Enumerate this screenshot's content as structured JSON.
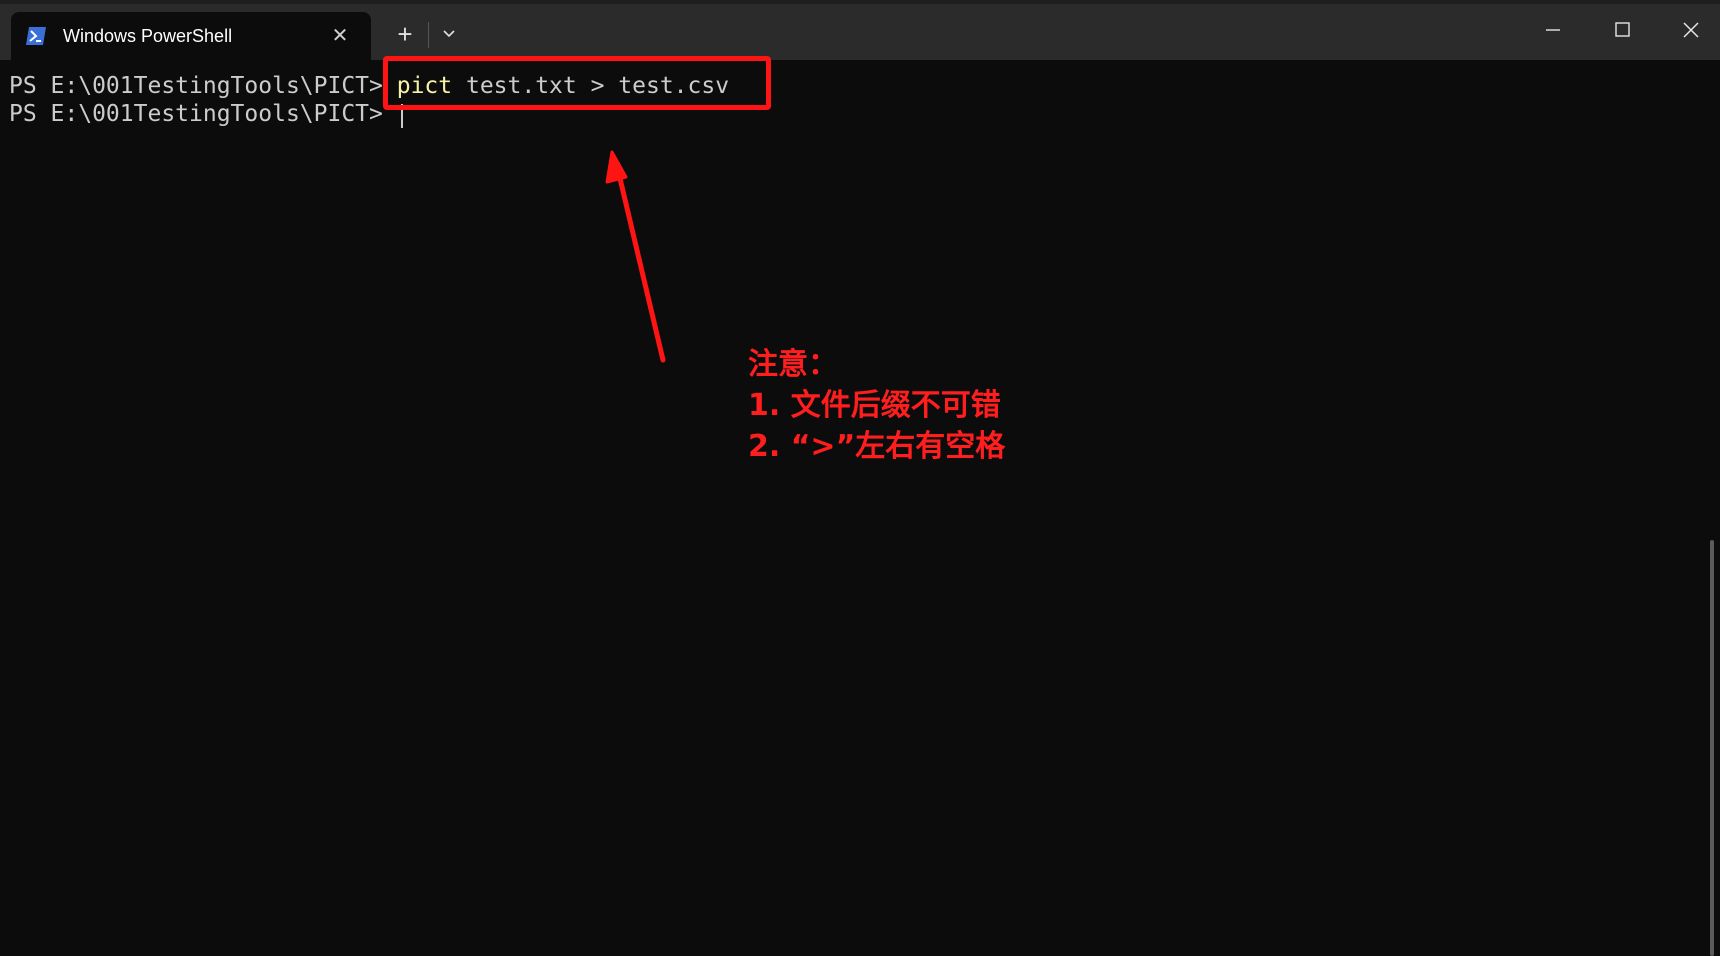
{
  "window": {
    "tab_title": "Windows PowerShell",
    "tab_icon": "powershell-icon",
    "close_tab_glyph": "✕",
    "new_tab_glyph": "+",
    "accent": "#3a6fd8"
  },
  "terminal": {
    "prompt1": "PS E:\\001TestingTools\\PICT> ",
    "command_name": "pict",
    "command_args": " test.txt > test.csv",
    "prompt2": "PS E:\\001TestingTools\\PICT> ",
    "background": "#0c0c0c",
    "text_color": "#cccccc",
    "command_color": "#f9f1a5"
  },
  "annotation": {
    "color": "#ff1414",
    "title": "注意：",
    "item1": "1. 文件后缀不可错",
    "item2": "2. “>”左右有空格"
  }
}
